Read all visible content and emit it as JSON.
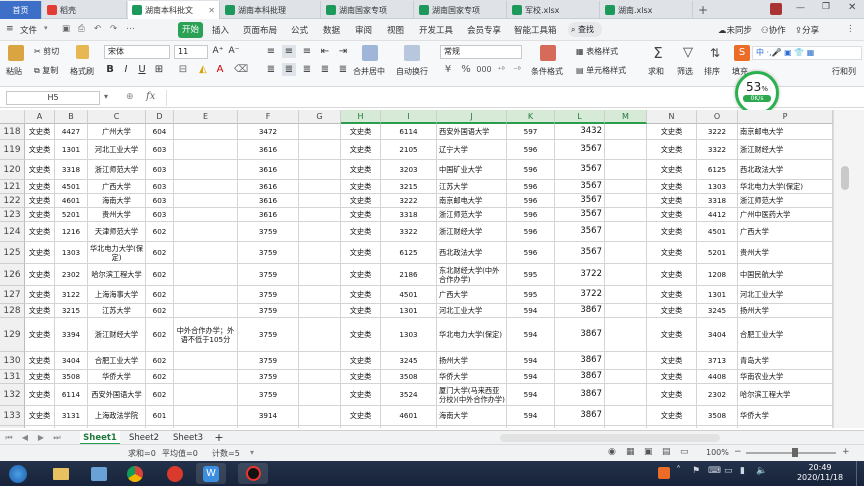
{
  "tabs": [
    {
      "label": "首页",
      "type": "home"
    },
    {
      "label": "稻壳",
      "type": "wps"
    },
    {
      "label": "湖南本科批文",
      "type": "xl",
      "active": true
    },
    {
      "label": "湖南本科批理",
      "type": "xl"
    },
    {
      "label": "湖南国家专项",
      "type": "xl"
    },
    {
      "label": "湖南国家专项",
      "type": "xl"
    },
    {
      "label": "军校.xlsx",
      "type": "xl"
    },
    {
      "label": "湖南.xlsx",
      "type": "xl"
    }
  ],
  "menu": {
    "file": "文件",
    "start": "开始",
    "items": [
      "插入",
      "页面布局",
      "公式",
      "数据",
      "审阅",
      "视图",
      "开发工具",
      "会员专享",
      "智能工具箱"
    ],
    "search": "查找",
    "unsync": "未同步",
    "collab": "协作",
    "share": "分享"
  },
  "ribbon": {
    "paste": "粘贴",
    "cut": "剪切",
    "copy": "复制",
    "format_painter": "格式刷",
    "font_name": "宋体",
    "font_size": "11",
    "merge": "合并居中",
    "wrap": "自动换行",
    "number_format": "常规",
    "cond_format": "条件格式",
    "table_style": "表格样式",
    "cell_style": "单元格样式",
    "sum": "求和",
    "filter": "筛选",
    "sort": "排序",
    "fill": "填充",
    "row_col": "行和列"
  },
  "formula": {
    "namebox": "H5",
    "fx": "fx"
  },
  "columns": [
    "A",
    "B",
    "C",
    "D",
    "E",
    "F",
    "G",
    "H",
    "I",
    "J",
    "K",
    "L",
    "M",
    "N",
    "O",
    "P"
  ],
  "rows": [
    {
      "n": "118",
      "c": [
        "文史类",
        "4427",
        "广州大学",
        "604",
        "",
        "3472",
        "",
        "文史类",
        "6114",
        "西安外国语大学",
        "597",
        "3432",
        "",
        "文史类",
        "3222",
        "南京邮电大学"
      ]
    },
    {
      "n": "119",
      "c": [
        "文史类",
        "1301",
        "河北工业大学",
        "603",
        "",
        "3616",
        "",
        "文史类",
        "2105",
        "辽宁大学",
        "596",
        "3567",
        "",
        "文史类",
        "3322",
        "浙江财经大学"
      ]
    },
    {
      "n": "120",
      "c": [
        "文史类",
        "3318",
        "浙江师范大学",
        "603",
        "",
        "3616",
        "",
        "文史类",
        "3203",
        "中国矿业大学",
        "596",
        "3567",
        "",
        "文史类",
        "6125",
        "西北政法大学"
      ]
    },
    {
      "n": "121",
      "c": [
        "文史类",
        "4501",
        "广西大学",
        "603",
        "",
        "3616",
        "",
        "文史类",
        "3215",
        "江苏大学",
        "596",
        "3567",
        "",
        "文史类",
        "1303",
        "华北电力大学(保定)"
      ]
    },
    {
      "n": "122",
      "c": [
        "文史类",
        "4601",
        "海南大学",
        "603",
        "",
        "3616",
        "",
        "文史类",
        "3222",
        "南京邮电大学",
        "596",
        "3567",
        "",
        "文史类",
        "3318",
        "浙江师范大学"
      ]
    },
    {
      "n": "123",
      "c": [
        "文史类",
        "5201",
        "贵州大学",
        "603",
        "",
        "3616",
        "",
        "文史类",
        "3318",
        "浙江师范大学",
        "596",
        "3567",
        "",
        "文史类",
        "4412",
        "广州中医药大学"
      ]
    },
    {
      "n": "124",
      "c": [
        "文史类",
        "1216",
        "天津师范大学",
        "602",
        "",
        "3759",
        "",
        "文史类",
        "3322",
        "浙江财经大学",
        "596",
        "3567",
        "",
        "文史类",
        "4501",
        "广西大学"
      ]
    },
    {
      "n": "125",
      "c": [
        "文史类",
        "1303",
        "华北电力大学(保定)",
        "602",
        "",
        "3759",
        "",
        "文史类",
        "6125",
        "西北政法大学",
        "596",
        "3567",
        "",
        "文史类",
        "5201",
        "贵州大学"
      ]
    },
    {
      "n": "126",
      "c": [
        "文史类",
        "2302",
        "哈尔滨工程大学",
        "602",
        "",
        "3759",
        "",
        "文史类",
        "2186",
        "东北财经大学(中外合作办学)",
        "595",
        "3722",
        "",
        "文史类",
        "1208",
        "中国民航大学"
      ]
    },
    {
      "n": "127",
      "c": [
        "文史类",
        "3122",
        "上海海事大学",
        "602",
        "",
        "3759",
        "",
        "文史类",
        "4501",
        "广西大学",
        "595",
        "3722",
        "",
        "文史类",
        "1301",
        "河北工业大学"
      ]
    },
    {
      "n": "128",
      "c": [
        "文史类",
        "3215",
        "江苏大学",
        "602",
        "",
        "3759",
        "",
        "文史类",
        "1301",
        "河北工业大学",
        "594",
        "3867",
        "",
        "文史类",
        "3245",
        "扬州大学"
      ]
    },
    {
      "n": "129",
      "c": [
        "文史类",
        "3394",
        "浙江财经大学",
        "602",
        "中外合作办学；外语不低于105分",
        "3759",
        "",
        "文史类",
        "1303",
        "华北电力大学(保定)",
        "594",
        "3867",
        "",
        "文史类",
        "3404",
        "合肥工业大学"
      ]
    },
    {
      "n": "130",
      "c": [
        "文史类",
        "3404",
        "合肥工业大学",
        "602",
        "",
        "3759",
        "",
        "文史类",
        "3245",
        "扬州大学",
        "594",
        "3867",
        "",
        "文史类",
        "3713",
        "青岛大学"
      ]
    },
    {
      "n": "131",
      "c": [
        "文史类",
        "3508",
        "华侨大学",
        "602",
        "",
        "3759",
        "",
        "文史类",
        "3508",
        "华侨大学",
        "594",
        "3867",
        "",
        "文史类",
        "4408",
        "华南农业大学"
      ]
    },
    {
      "n": "132",
      "c": [
        "文史类",
        "6114",
        "西安外国语大学",
        "602",
        "",
        "3759",
        "",
        "文史类",
        "3524",
        "厦门大学(马来西亚分校)(中外合作办学)",
        "594",
        "3867",
        "",
        "文史类",
        "2302",
        "哈尔滨工程大学"
      ]
    },
    {
      "n": "133",
      "c": [
        "文史类",
        "3131",
        "上海政法学院",
        "601",
        "",
        "3914",
        "",
        "文史类",
        "4601",
        "海南大学",
        "594",
        "3867",
        "",
        "文史类",
        "3508",
        "华侨大学"
      ]
    },
    {
      "n": "134",
      "c": [
        "文史类",
        "3524",
        "厦门大学(马来西亚分校)",
        "601",
        "中外合作办学；外语不低于120分",
        "3914",
        "",
        "文史类",
        "3335",
        "宁波诺丁汉大学",
        "593",
        "4013",
        "",
        "文史类",
        "3524",
        "厦门大学(马来西亚分校)(中外合作办学)"
      ]
    },
    {
      "n": "135",
      "c": [
        "文史类",
        "4001",
        "郑州大学",
        "601",
        "",
        "3914",
        "",
        "文史类",
        "3713",
        "青岛大学",
        "593",
        "4013",
        "",
        "文史类",
        "4425",
        "暨南大学"
      ]
    }
  ],
  "sheets": [
    "Sheet1",
    "Sheet2",
    "Sheet3"
  ],
  "status": {
    "sum": "求和=0",
    "avg": "平均值=0",
    "count": "计数=5",
    "zoom": "100%"
  },
  "net": {
    "percent": "53",
    "unit": "%",
    "speed": "0K/s"
  },
  "clock": {
    "time": "20:49",
    "date": "2020/11/18"
  },
  "colors": {
    "accent": "#2aa154",
    "home_tab": "#3d6fc9",
    "taskbar": "#1b2a44"
  }
}
